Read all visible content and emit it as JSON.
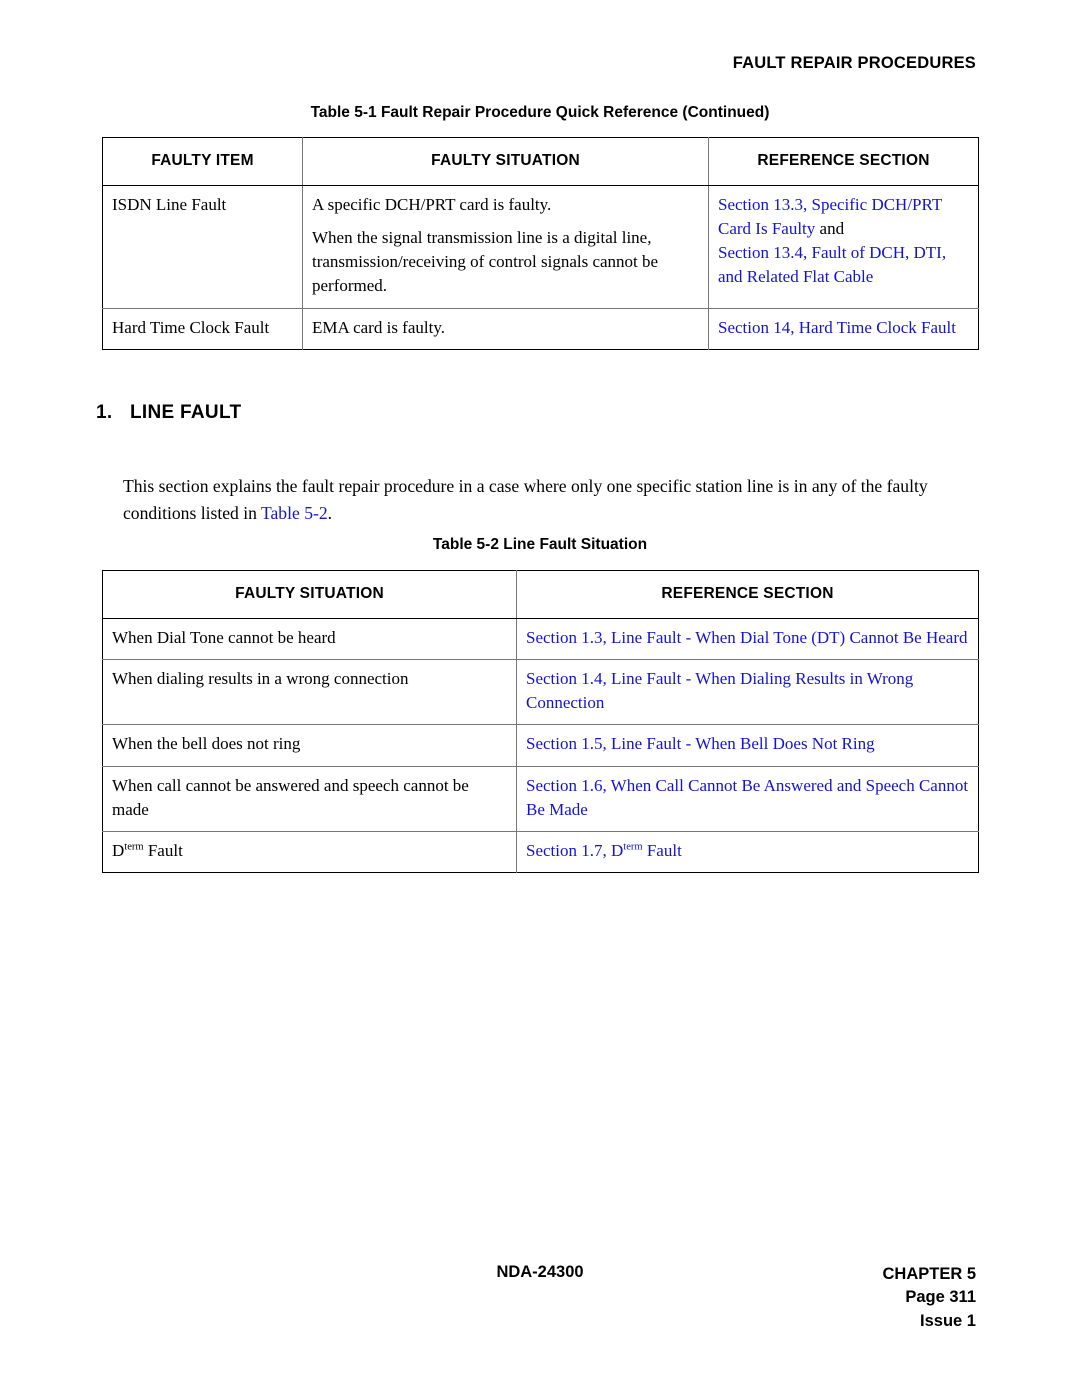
{
  "header": {
    "running_head": "FAULT REPAIR PROCEDURES"
  },
  "table_1": {
    "caption": "Table 5-1  Fault Repair Procedure Quick Reference (Continued)",
    "columns": [
      "FAULTY ITEM",
      "FAULTY SITUATION",
      "REFERENCE SECTION"
    ],
    "rows": [
      {
        "faulty_item": "ISDN Line Fault",
        "situation_1": "A specific DCH/PRT card is faulty.",
        "situation_2": "When the signal transmission line is a digital line, transmission/receiving of control signals cannot be performed.",
        "ref_1": "Section 13.3, Specific DCH/PRT Card Is Faulty",
        "ref_joiner": " and",
        "ref_2": "Section 13.4, Fault of DCH, DTI, and Related Flat Cable"
      },
      {
        "faulty_item": "Hard Time Clock Fault",
        "situation_1": "EMA card is faulty.",
        "ref_1": "Section 14, Hard Time Clock Fault"
      }
    ]
  },
  "section": {
    "number": "1.",
    "title": "LINE FAULT",
    "paragraph_before": "This section explains the fault repair procedure in a case where only one specific station line is in any of the faulty conditions listed in ",
    "paragraph_link": "Table 5-2",
    "paragraph_after": "."
  },
  "table_2": {
    "caption": "Table 5-2  Line Fault Situation",
    "columns": [
      "FAULTY SITUATION",
      "REFERENCE SECTION"
    ],
    "rows": [
      {
        "situation": "When Dial Tone cannot be heard",
        "reference": "Section 1.3, Line Fault - When Dial Tone (DT) Cannot Be Heard"
      },
      {
        "situation": "When dialing results in a wrong connection",
        "reference": "Section 1.4, Line Fault - When Dialing Results in Wrong Connection"
      },
      {
        "situation": "When the bell does not ring",
        "reference": "Section 1.5, Line Fault - When Bell Does Not Ring"
      },
      {
        "situation": "When call cannot be answered and speech cannot be made",
        "reference": "Section 1.6, When Call Cannot Be Answered and Speech Cannot Be Made"
      },
      {
        "situation_prefix": "D",
        "situation_sup": "term",
        "situation_suffix": " Fault",
        "reference_prefix": "Section 1.7, D",
        "reference_sup": "term",
        "reference_suffix": " Fault"
      }
    ]
  },
  "footer": {
    "document_number": "NDA-24300",
    "chapter": "CHAPTER  5",
    "page": "Page 311",
    "issue": "Issue  1"
  },
  "colors": {
    "reference_link": "#1414cc",
    "text": "#000000",
    "background": "#ffffff",
    "table_border": "#000000",
    "table_rule": "#777777"
  }
}
